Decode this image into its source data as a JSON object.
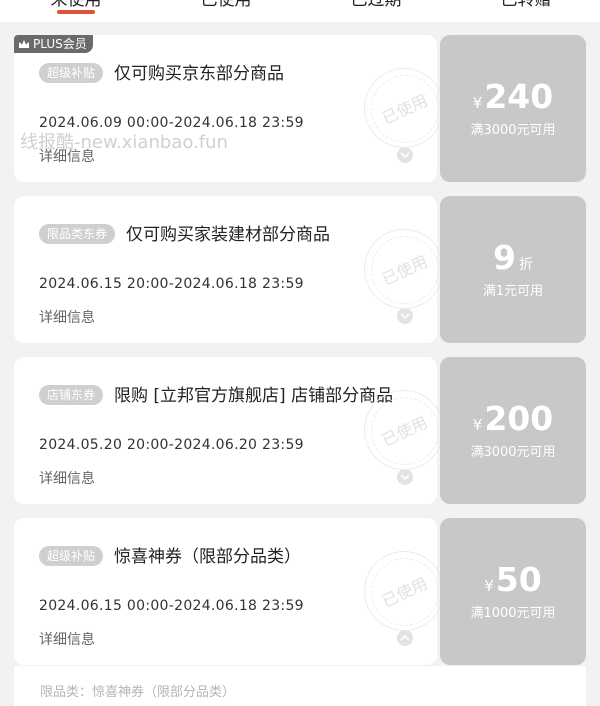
{
  "tabs": {
    "items": [
      {
        "label": "未使用"
      },
      {
        "label": "已使用"
      },
      {
        "label": "已过期"
      },
      {
        "label": "已转赠"
      }
    ]
  },
  "plus_badge": {
    "label": "PLUS会员",
    "icon": "crown-icon"
  },
  "watermark": {
    "text": "线报酷-new.xianbao.fun"
  },
  "coupons": [
    {
      "tag": "超级补贴",
      "title": "仅可购买京东部分商品",
      "time": "2024.06.09 00:00-2024.06.18 23:59",
      "detail": "详细信息",
      "stamp": "已使用",
      "currency": "¥",
      "amount": "240",
      "condition": "满3000元可用"
    },
    {
      "tag": "限品类东券",
      "title": "仅可购买家装建材部分商品",
      "time": "2024.06.15 20:00-2024.06.18 23:59",
      "detail": "详细信息",
      "stamp": "已使用",
      "amount": "9",
      "unit": "折",
      "condition": "满1元可用"
    },
    {
      "tag": "店铺东券",
      "title": "限购 [立邦官方旗舰店] 店铺部分商品",
      "time": "2024.05.20 20:00-2024.06.20 23:59",
      "detail": "详细信息",
      "stamp": "已使用",
      "currency": "¥",
      "amount": "200",
      "condition": "满3000元可用"
    },
    {
      "tag": "超级补贴",
      "title": "惊喜神券（限部分品类）",
      "time": "2024.06.15 00:00-2024.06.18 23:59",
      "detail": "详细信息",
      "stamp": "已使用",
      "currency": "¥",
      "amount": "50",
      "condition": "满1000元可用"
    }
  ],
  "expanded_detail": {
    "text": "限品类：惊喜神券（限部分品类）"
  },
  "colors": {
    "accent": "#e0533b",
    "used_gray": "#c8c8c8",
    "tag_gray": "#cfcfcf"
  }
}
